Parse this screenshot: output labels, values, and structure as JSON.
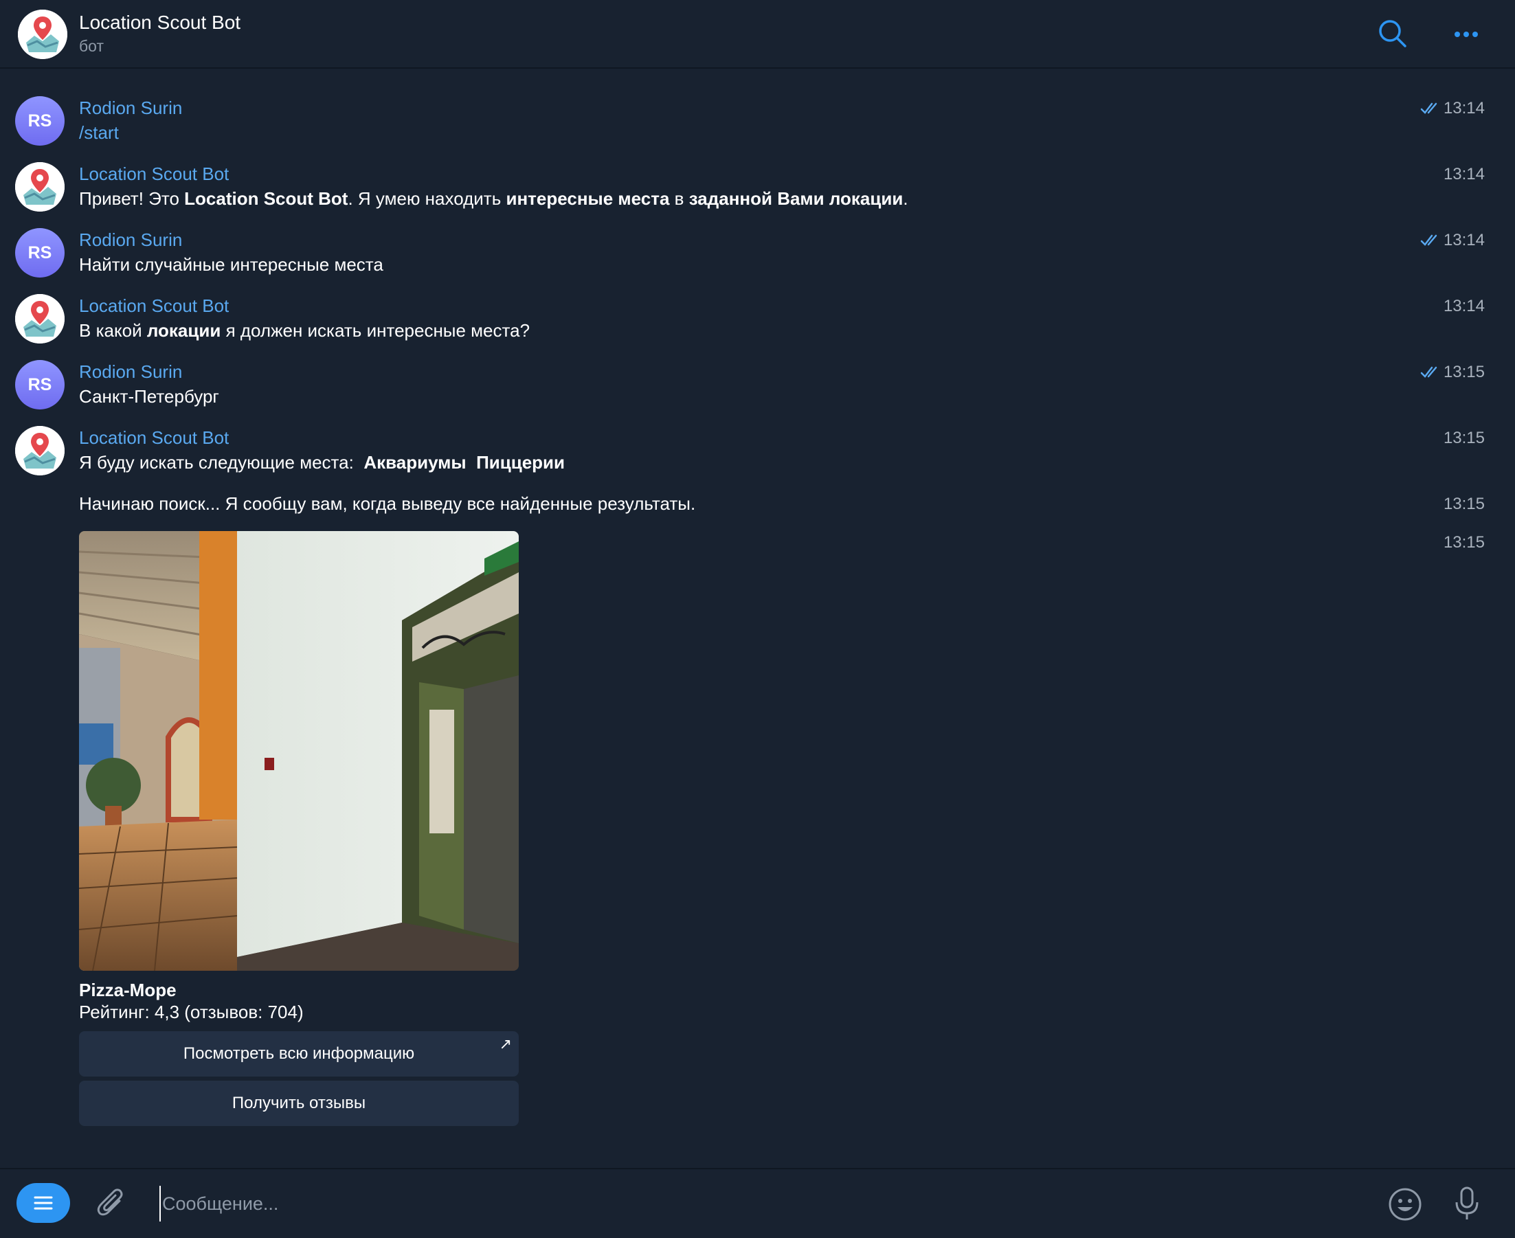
{
  "header": {
    "title": "Location Scout Bot",
    "subtitle": "бот"
  },
  "messages": [
    {
      "sender": "Rodion Surin",
      "text": "/start",
      "time": "13:14"
    },
    {
      "sender": "Location Scout Bot",
      "parts": [
        "Привет! Это ",
        "Location Scout Bot",
        ". Я умею находить ",
        "интересные места",
        " в ",
        "заданной Вами локации",
        "."
      ],
      "time": "13:14"
    },
    {
      "sender": "Rodion Surin",
      "text": "Найти случайные интересные места",
      "time": "13:14"
    },
    {
      "sender": "Location Scout Bot",
      "parts": [
        "В какой ",
        "локации",
        " я должен искать интересные места?"
      ],
      "time": "13:14"
    },
    {
      "sender": "Rodion Surin",
      "text": "Санкт-Петербург",
      "time": "13:15"
    },
    {
      "sender": "Location Scout Bot",
      "parts": [
        "Я буду искать следующие места:  ",
        "Аквариумы  Пиццерии"
      ],
      "time": "13:15"
    },
    {
      "text": "Начинаю поиск... Я сообщу вам, когда выведу все найденные результаты.",
      "time": "13:15"
    },
    {
      "time": "13:15",
      "card": {
        "title": "Pizza-Море",
        "rating": "Рейтинг: 4,3 (отзывов: 704)",
        "button_info": "Посмотреть всю информацию",
        "button_reviews": "Получить отзывы"
      }
    }
  ],
  "user_initials": "RS",
  "composer": {
    "placeholder": "Сообщение..."
  },
  "colors": {
    "background": "#182230",
    "accent": "#5aa9f0",
    "button": "#233044",
    "menu_button": "#2d95f2"
  },
  "icons": [
    "search-icon",
    "more-icon",
    "menu-icon",
    "attach-icon",
    "emoji-icon",
    "microphone-icon",
    "double-check-icon",
    "open-link-icon"
  ]
}
